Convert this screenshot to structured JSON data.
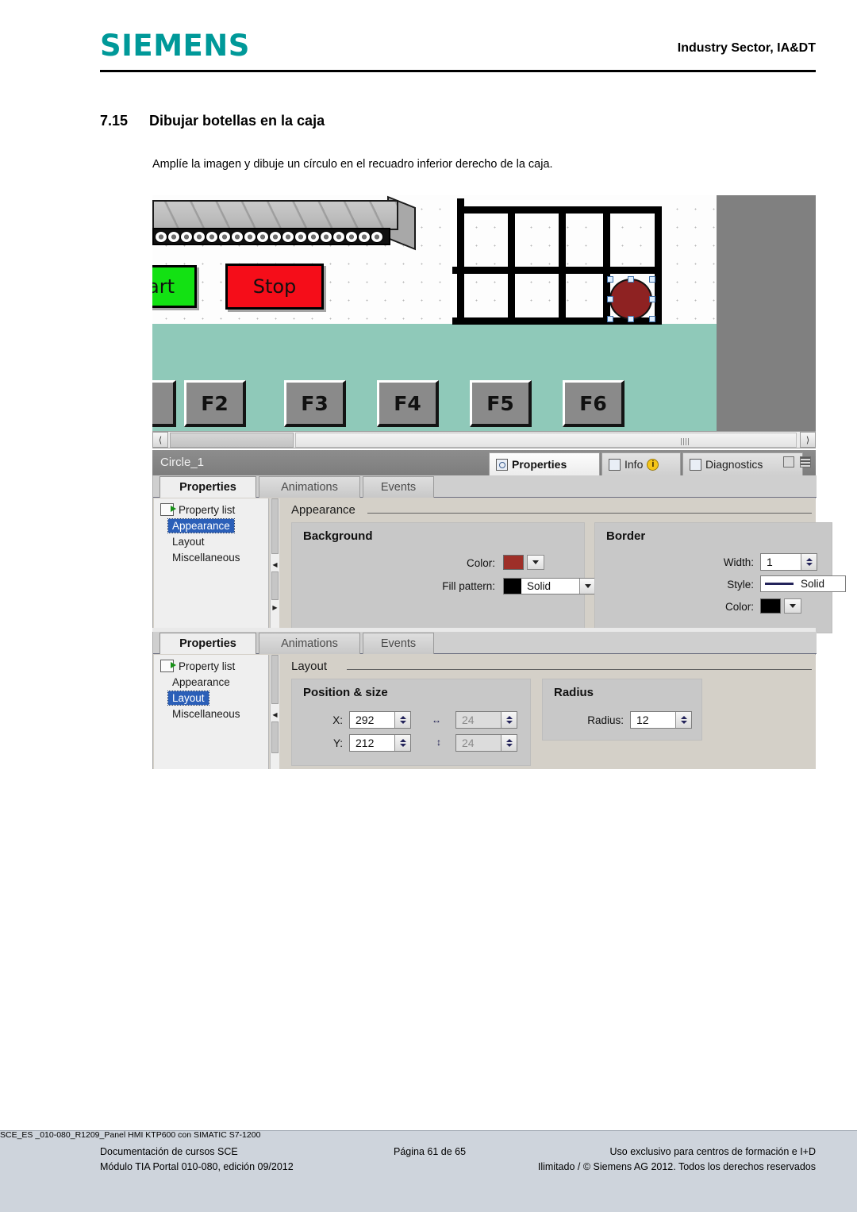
{
  "header": {
    "logo": "SIEMENS",
    "right_label": "Industry Sector, IA&DT"
  },
  "section": {
    "number": "7.15",
    "title": "Dibujar botellas en la caja",
    "paragraph": "Amplíe la imagen y dibuje un círculo en el recuadro inferior derecho de la caja."
  },
  "figure": {
    "hmi": {
      "start_button_label": "art",
      "stop_button_label": "Stop",
      "function_keys": [
        "",
        "F2",
        "F3",
        "F4",
        "F5",
        "F6"
      ],
      "canvas_color": "#8fc9b9",
      "circle_color": "#8e2222"
    },
    "inspector": {
      "object_name": "Circle_1",
      "top_tabs": [
        {
          "label": "Properties",
          "icon": "magnifier-icon",
          "active": true
        },
        {
          "label": "Info",
          "icon": "info-icon",
          "badge": "i",
          "active": false
        },
        {
          "label": "Diagnostics",
          "icon": "diagnostics-icon",
          "active": false
        }
      ]
    },
    "panel_appearance": {
      "tabs": [
        {
          "label": "Properties",
          "active": true
        },
        {
          "label": "Animations",
          "active": false
        },
        {
          "label": "Events",
          "active": false
        }
      ],
      "nav": {
        "property_list": "Property list",
        "items": [
          {
            "label": "Appearance",
            "selected": true
          },
          {
            "label": "Layout",
            "selected": false
          },
          {
            "label": "Miscellaneous",
            "selected": false
          }
        ]
      },
      "content_title": "Appearance",
      "background": {
        "group_title": "Background",
        "color_label": "Color:",
        "color_value": "#9e2f28",
        "fill_pattern_label": "Fill pattern:",
        "fill_pattern_value": "Solid",
        "fill_pattern_swatch": "#000000"
      },
      "border": {
        "group_title": "Border",
        "width_label": "Width:",
        "width_value": "1",
        "style_label": "Style:",
        "style_value": "Solid",
        "color_label": "Color:",
        "color_value": "#000000"
      }
    },
    "panel_layout": {
      "tabs": [
        {
          "label": "Properties",
          "active": true
        },
        {
          "label": "Animations",
          "active": false
        },
        {
          "label": "Events",
          "active": false
        }
      ],
      "nav": {
        "property_list": "Property list",
        "items": [
          {
            "label": "Appearance",
            "selected": false
          },
          {
            "label": "Layout",
            "selected": true
          },
          {
            "label": "Miscellaneous",
            "selected": false
          }
        ]
      },
      "content_title": "Layout",
      "position_size": {
        "group_title": "Position & size",
        "x_label": "X:",
        "x_value": "292",
        "y_label": "Y:",
        "y_value": "212",
        "width_value": "24",
        "height_value": "24"
      },
      "radius": {
        "group_title": "Radius",
        "label": "Radius:",
        "value": "12"
      }
    }
  },
  "footer": {
    "left_line1": "Documentación de cursos SCE",
    "left_line2": "Módulo TIA Portal 010-080, edición 09/2012",
    "mid_line1": "Página 61 de 65",
    "right_line1": "Uso exclusivo para centros de formación e I+D",
    "right_line2": "Ilimitado / © Siemens AG 2012. Todos los derechos reservados",
    "code": "SCE_ES _010-080_R1209_Panel HMI KTP600 con SIMATIC S7-1200"
  }
}
